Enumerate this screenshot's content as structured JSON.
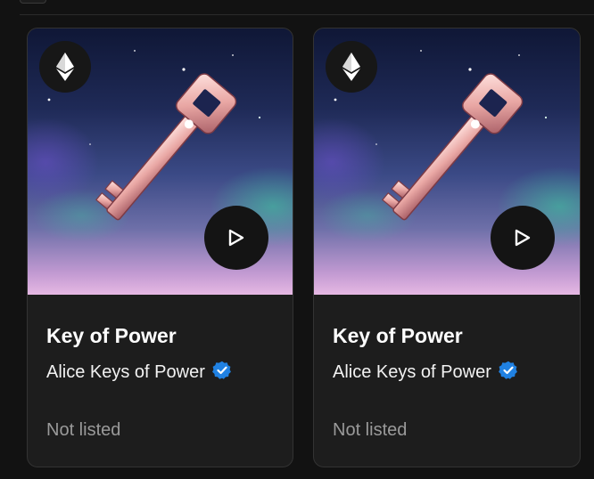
{
  "cards": [
    {
      "title": "Key of Power",
      "creator": "Alice Keys of Power",
      "status": "Not listed",
      "chain_icon": "ethereum-icon",
      "media_action_icon": "play-icon",
      "verified_icon": "verified-badge-icon"
    },
    {
      "title": "Key of Power",
      "creator": "Alice Keys of Power",
      "status": "Not listed",
      "chain_icon": "ethereum-icon",
      "media_action_icon": "play-icon",
      "verified_icon": "verified-badge-icon"
    }
  ],
  "colors": {
    "background": "#121212",
    "card": "#1d1d1d",
    "verified": "#2081e2",
    "muted_text": "#9a9a9a"
  }
}
